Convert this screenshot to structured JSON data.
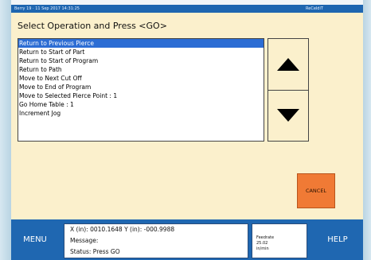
{
  "titlebar": {
    "datetime": "Berry 19 · 11 Sep 2017 14:31:25",
    "hostname": "ReCeldiT"
  },
  "heading": "Select Operation and Press <GO>",
  "operations": [
    {
      "label": "Return to Previous Pierce",
      "selected": true
    },
    {
      "label": "Return to Start of Part",
      "selected": false
    },
    {
      "label": "Return to Start of Program",
      "selected": false
    },
    {
      "label": "Return to Path",
      "selected": false
    },
    {
      "label": "Move to Next Cut Off",
      "selected": false
    },
    {
      "label": "Move to End of Program",
      "selected": false
    },
    {
      "label": "Move to Selected Pierce Point : 1",
      "selected": false
    },
    {
      "label": "Go Home Table : 1",
      "selected": false
    },
    {
      "label": "Increment Jog",
      "selected": false
    }
  ],
  "scroll": {
    "up_icon": "triangle-up-icon",
    "down_icon": "triangle-down-icon"
  },
  "cancel_label": "CANCEL",
  "bottombar": {
    "menu_label": "MENU",
    "help_label": "HELP",
    "position_readout": "X (in): 0010.1648   Y (in): -000.9988",
    "message_label": "Message:",
    "status_text": "Status:  Press GO",
    "feedrate": {
      "label": "Feedrate",
      "value": "25.02",
      "units": "in/min"
    }
  },
  "colors": {
    "screen_bg": "#fbf0cc",
    "bar_blue": "#1f67b1",
    "selection": "#2c6dd4",
    "cancel": "#f07a35"
  }
}
